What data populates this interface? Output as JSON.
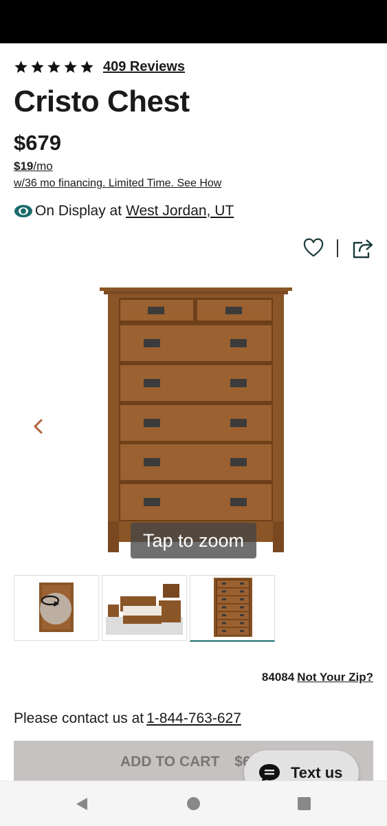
{
  "rating": {
    "stars": 5,
    "reviews_label": "409 Reviews"
  },
  "product": {
    "title": "Cristo Chest",
    "price": "$679",
    "monthly_amount": "$19",
    "monthly_suffix": "/mo",
    "financing_text": "w/36 mo financing. Limited Time. See How",
    "display_prefix": "On Display at",
    "display_store": "West Jordan, UT"
  },
  "gallery": {
    "zoom_hint": "Tap to zoom",
    "thumbnails": [
      "chest-360-view",
      "bedroom-set",
      "chest-front"
    ],
    "active_index": 2
  },
  "location": {
    "zip": "84084",
    "change_label": "Not Your Zip?"
  },
  "contact": {
    "prefix": "Please contact us at",
    "phone": "1-844-763-627"
  },
  "cart": {
    "label": "ADD TO CART",
    "price": "$679"
  },
  "chat": {
    "label": "Text us"
  },
  "colors": {
    "accent": "#1a6b6b",
    "cart_button": "#c6c2c2",
    "wood": "#8a5527",
    "arrow": "#b0623a"
  }
}
